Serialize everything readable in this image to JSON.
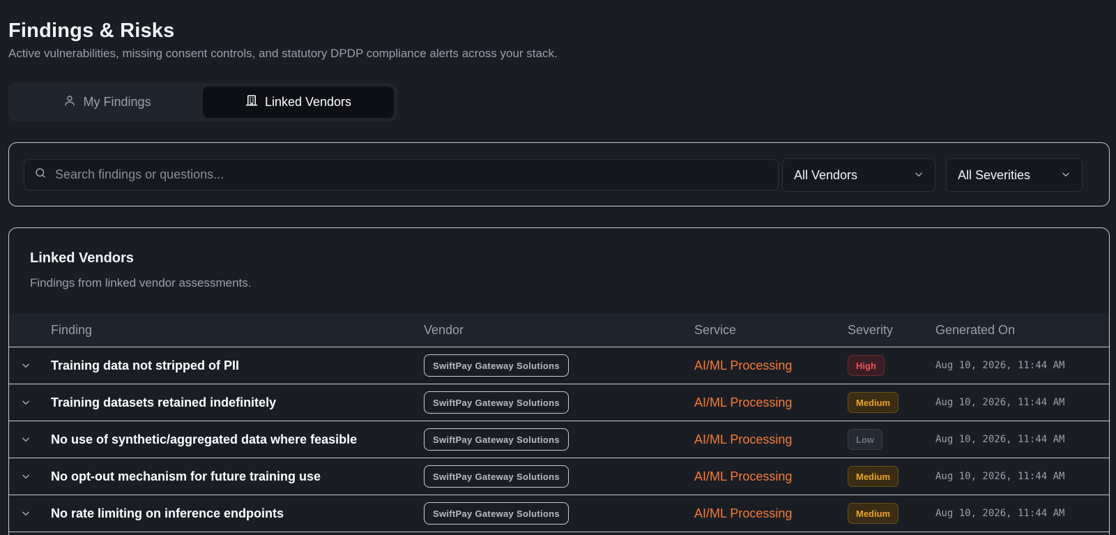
{
  "page": {
    "title": "Findings & Risks",
    "subtitle": "Active vulnerabilities, missing consent controls, and statutory DPDP compliance alerts across your stack."
  },
  "tabs": [
    {
      "label": "My Findings",
      "icon": "user-icon",
      "active": false
    },
    {
      "label": "Linked Vendors",
      "icon": "building-icon",
      "active": true
    }
  ],
  "filters": {
    "search_placeholder": "Search findings or questions...",
    "vendor_select": "All Vendors",
    "severity_select": "All Severities"
  },
  "card": {
    "title": "Linked Vendors",
    "subtitle": "Findings from linked vendor assessments."
  },
  "table": {
    "columns": [
      "Finding",
      "Vendor",
      "Service",
      "Severity",
      "Generated On"
    ],
    "rows": [
      {
        "finding": "Training data not stripped of PII",
        "vendor": "SwiftPay Gateway Solutions",
        "service": "AI/ML Processing",
        "severity": "High",
        "generated": "Aug 10, 2026, 11:44 AM"
      },
      {
        "finding": "Training datasets retained indefinitely",
        "vendor": "SwiftPay Gateway Solutions",
        "service": "AI/ML Processing",
        "severity": "Medium",
        "generated": "Aug 10, 2026, 11:44 AM"
      },
      {
        "finding": "No use of synthetic/aggregated data where feasible",
        "vendor": "SwiftPay Gateway Solutions",
        "service": "AI/ML Processing",
        "severity": "Low",
        "generated": "Aug 10, 2026, 11:44 AM"
      },
      {
        "finding": "No opt-out mechanism for future training use",
        "vendor": "SwiftPay Gateway Solutions",
        "service": "AI/ML Processing",
        "severity": "Medium",
        "generated": "Aug 10, 2026, 11:44 AM"
      },
      {
        "finding": "No rate limiting on inference endpoints",
        "vendor": "SwiftPay Gateway Solutions",
        "service": "AI/ML Processing",
        "severity": "Medium",
        "generated": "Aug 10, 2026, 11:44 AM"
      }
    ]
  },
  "colors": {
    "background": "#1a1d24",
    "accent_service": "#f97a36",
    "severity_high": "#f0555f",
    "severity_medium": "#eaa52a",
    "severity_low": "#6f7580"
  }
}
